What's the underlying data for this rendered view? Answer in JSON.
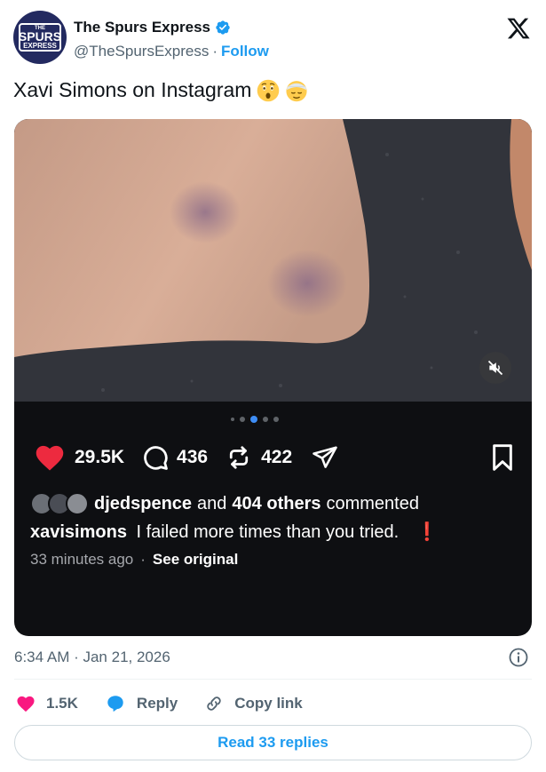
{
  "account": {
    "name": "The Spurs Express",
    "handle": "@TheSpursExpress",
    "separator": "·",
    "follow_label": "Follow",
    "avatar_text": {
      "line1": "THE",
      "line2": "SPURS",
      "line3": "EXPRESS"
    },
    "verified_icon": "verified-badge-icon"
  },
  "tweet": {
    "text": "Xavi Simons on Instagram",
    "emojis": [
      "astonished-face-emoji",
      "head-bandage-emoji"
    ]
  },
  "embed": {
    "carousel": {
      "total_dots": 5,
      "active_index": 2
    },
    "likes": "29.5K",
    "comments": "436",
    "reposts": "422",
    "commented_user": "djedspence",
    "commented_middle": "and",
    "commented_others": "404 others",
    "commented_suffix": "commented",
    "caption_user": "xavisimons",
    "caption_text": "I failed more times than you tried.",
    "caption_exclaim": "❗",
    "time_ago": "33 minutes ago",
    "meta_separator": "·",
    "see_original": "See original",
    "colors": {
      "heart": "#ed2a3f",
      "active_dot": "#3e8df5",
      "card_bg": "#0e0f12"
    }
  },
  "timestamp": "6:34 AM · Jan 21, 2026",
  "engagement": {
    "likes": "1.5K",
    "reply_label": "Reply",
    "copy_label": "Copy link",
    "colors": {
      "like_heart": "#f91880",
      "reply_bubble": "#1d9bf0"
    }
  },
  "read_replies_label": "Read 33 replies",
  "colors": {
    "link_blue": "#1d9bf0",
    "secondary_text": "#536471"
  }
}
